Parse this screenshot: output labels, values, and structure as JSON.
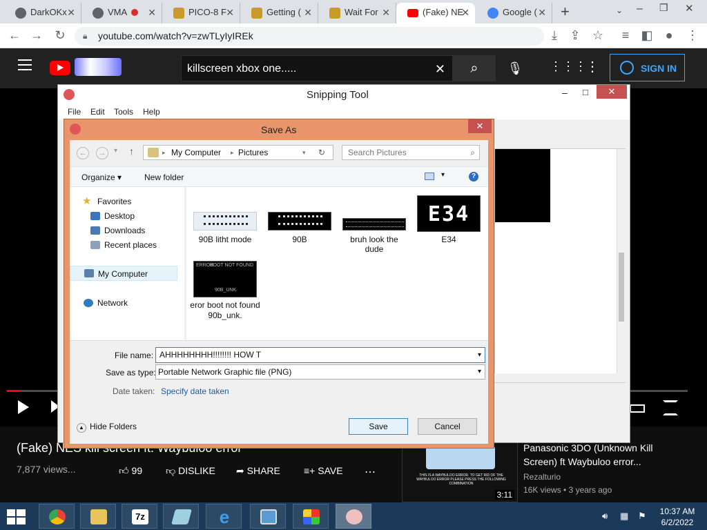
{
  "browser": {
    "tabs": [
      {
        "label": "DarkOKx",
        "color": "#5f6368"
      },
      {
        "label": "VMA",
        "color": "#5f6368"
      },
      {
        "label": "PICO-8 F",
        "color": "#c89b2a"
      },
      {
        "label": "Getting (",
        "color": "#c89b2a"
      },
      {
        "label": "Wait For",
        "color": "#c89b2a"
      },
      {
        "label": "(Fake) NE",
        "color": "#ff0000"
      },
      {
        "label": "Google (",
        "color": "#4285f4"
      }
    ],
    "url": "youtube.com/watch?v=zwTLyIyIREk"
  },
  "youtube": {
    "search_text": "killscreen xbox one.....",
    "signin": "SIGN IN",
    "video_title": "(Fake) NES kill screen ft. Waybuloo error",
    "views": "7,877 views...",
    "likes": "99",
    "dislike": "DISLIKE",
    "share": "SHARE",
    "save": "SAVE",
    "rec_title": "Panasonic 3DO (Unknown Kill Screen) ft Waybuloo error...",
    "rec_channel": "Rezalturio",
    "rec_meta": "16K views • 3 years ago",
    "rec_duration": "3:11",
    "rec_thumb_text": "THIS IS A WAYBULOO ERROR. TO GET RID OF THE WAYBULOO ERROR PLEASE PRESS THE FOLLOWING COMBINATION"
  },
  "snipping": {
    "title": "Snipping Tool",
    "menu": [
      "File",
      "Edit",
      "Tools",
      "Help"
    ]
  },
  "saveas": {
    "title": "Save As",
    "breadcrumb": [
      "My Computer",
      "Pictures"
    ],
    "search_placeholder": "Search Pictures",
    "organize": "Organize",
    "new_folder": "New folder",
    "nav": {
      "favorites": "Favorites",
      "desktop": "Desktop",
      "downloads": "Downloads",
      "recent": "Recent places",
      "mycomputer": "My Computer",
      "network": "Network"
    },
    "files": [
      {
        "name": "90B litht mode"
      },
      {
        "name": "90B"
      },
      {
        "name": "bruh look the dude"
      },
      {
        "name": "E34"
      },
      {
        "name": "eror boot not found 90b_unk."
      }
    ],
    "thumb_text": {
      "e34": "E34",
      "err1": "ERROR",
      "err2": "BOOT NOT FOUND",
      "err3": "90B_UNK"
    },
    "filename_label": "File name:",
    "filename_value": "AHHHHHHHH!!!!!!!! HOW T",
    "type_label": "Save as type:",
    "type_value": "Portable Network Graphic file (PNG)",
    "date_label": "Date taken:",
    "date_value": "Specify date taken",
    "hide_folders": "Hide Folders",
    "save": "Save",
    "cancel": "Cancel"
  },
  "taskbar": {
    "time": "10:37 AM",
    "date": "6/2/2022"
  }
}
